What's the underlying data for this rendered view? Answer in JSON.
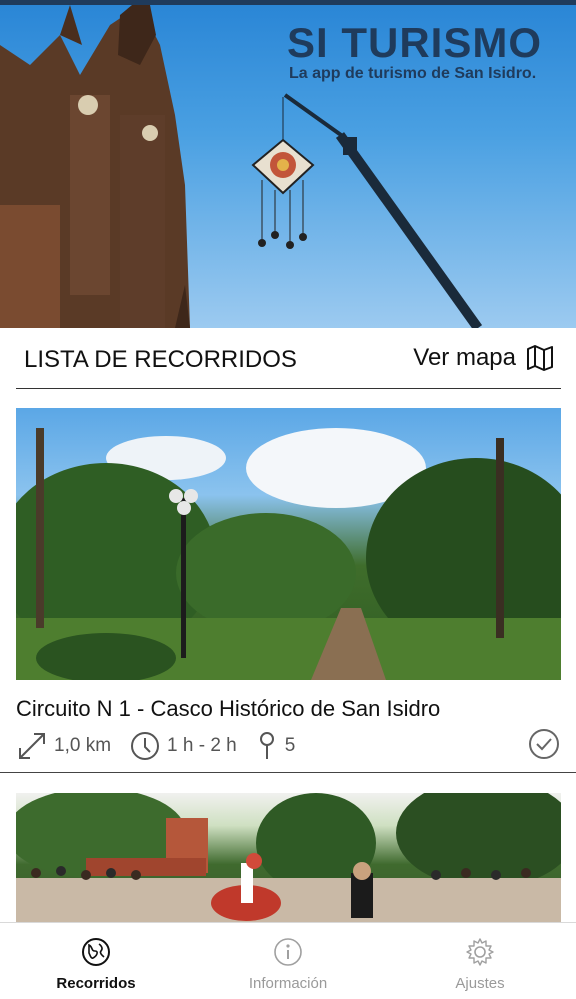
{
  "hero": {
    "title": "SI TURISMO",
    "subtitle": "La app de turismo de San Isidro."
  },
  "section": {
    "title": "LISTA DE RECORRIDOS",
    "map_label": "Ver mapa"
  },
  "tours": [
    {
      "title": "Circuito N 1 - Casco Histórico de San Isidro",
      "distance": "1,0 km",
      "duration": "1 h - 2 h",
      "stops": "5",
      "completed": true
    }
  ],
  "tabs": [
    {
      "label": "Recorridos",
      "icon": "globe-icon",
      "active": true
    },
    {
      "label": "Información",
      "icon": "info-icon",
      "active": false
    },
    {
      "label": "Ajustes",
      "icon": "gear-icon",
      "active": false
    }
  ],
  "colors": {
    "brand": "#1f3b5c",
    "text": "#111111",
    "muted": "#9a9a9a"
  }
}
